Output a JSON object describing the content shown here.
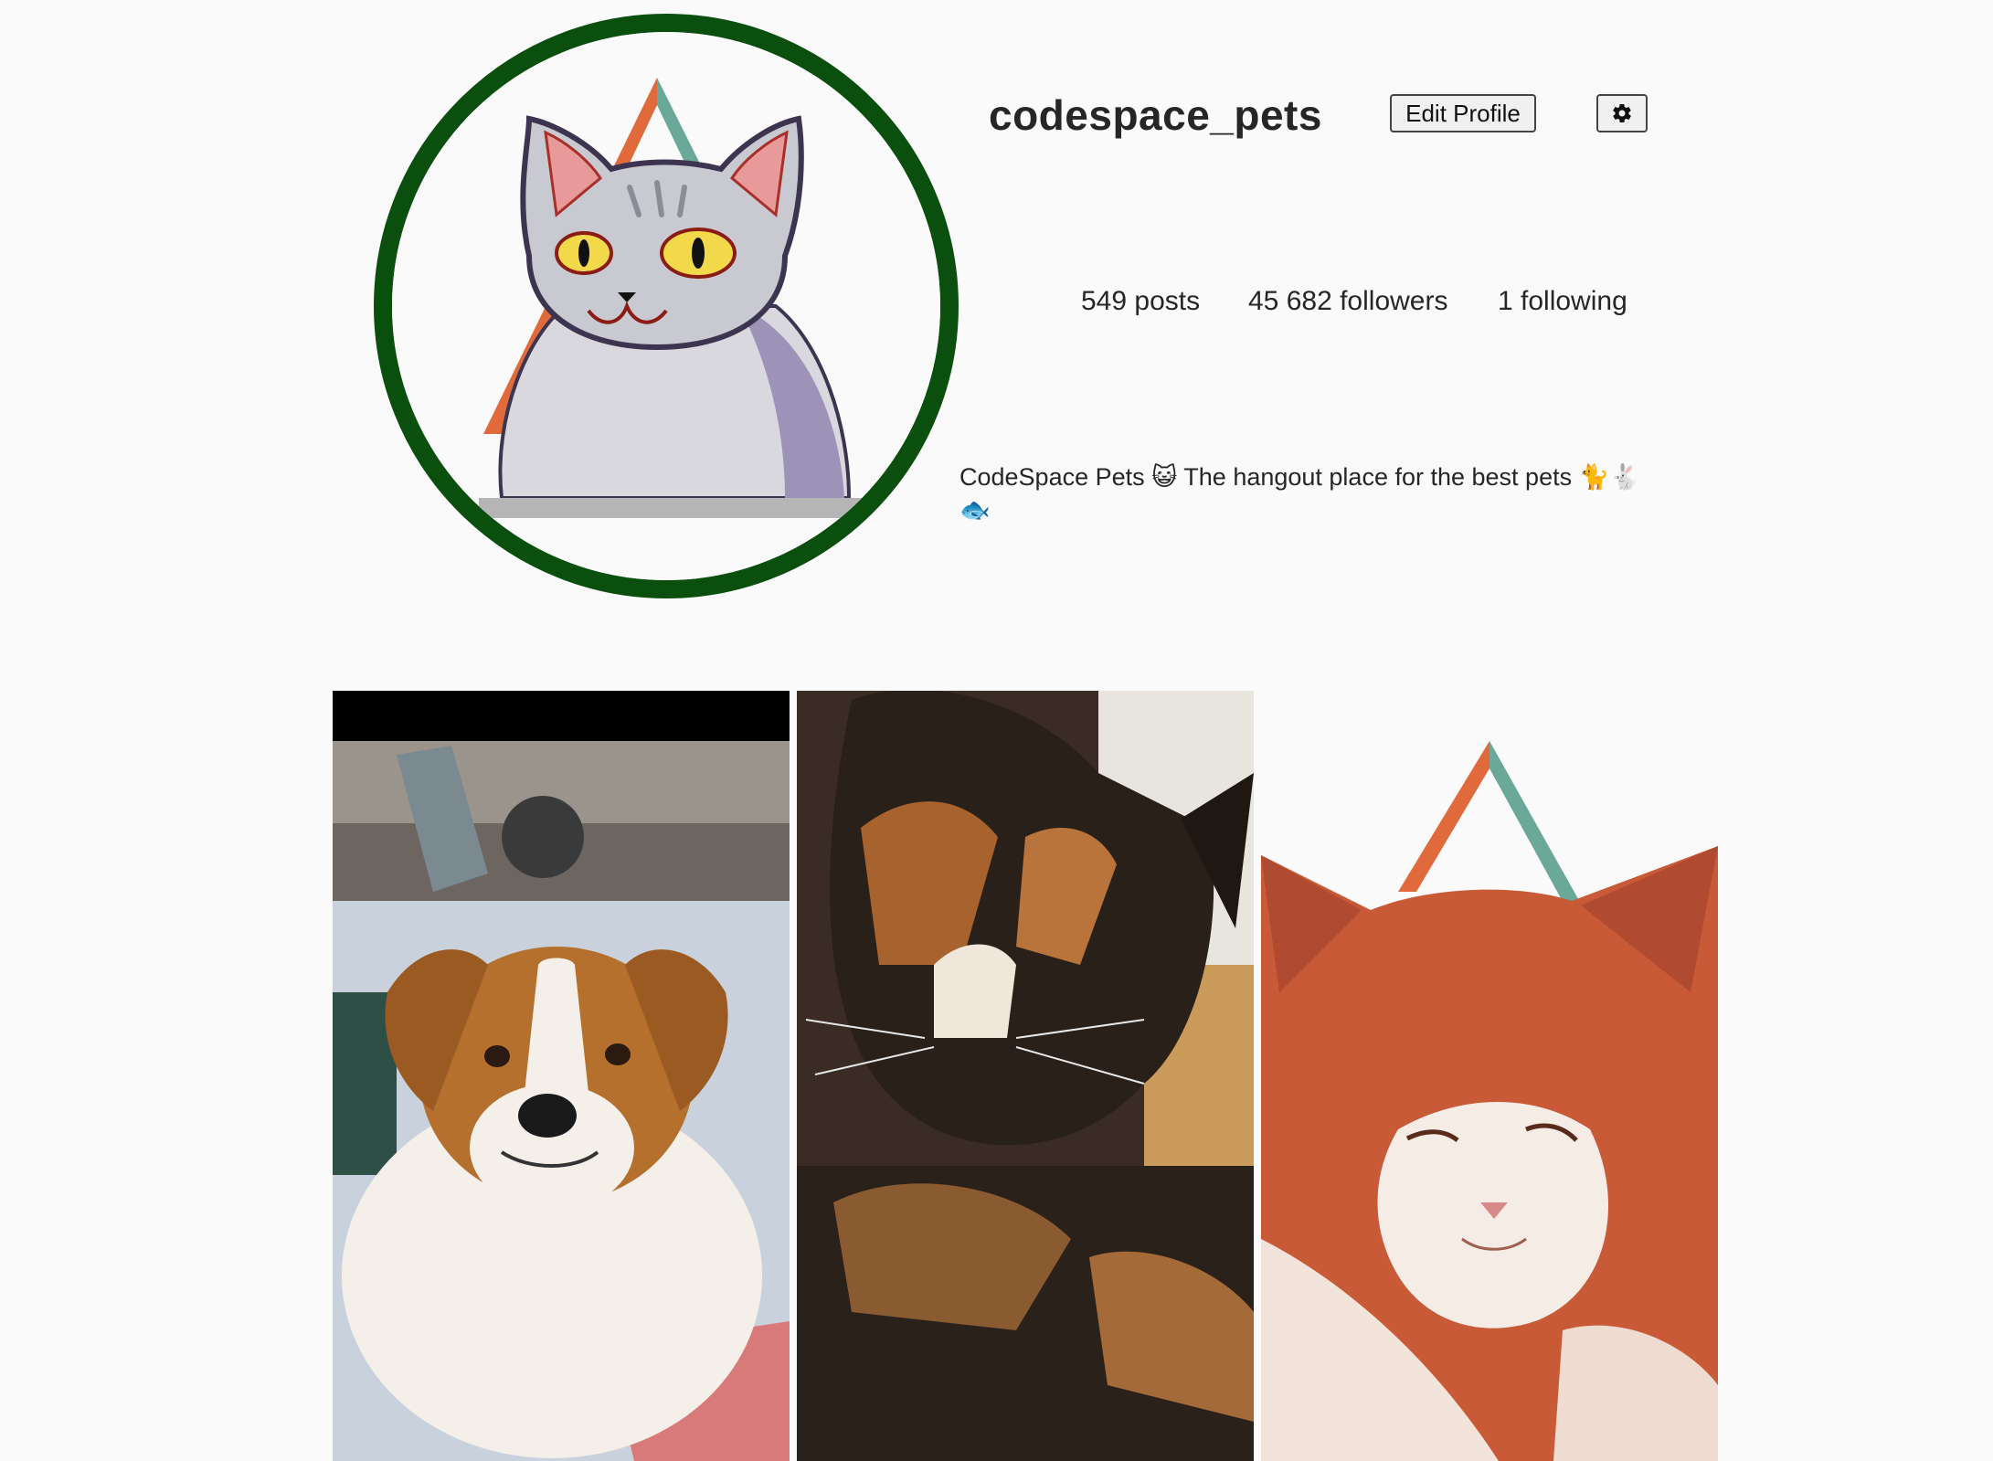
{
  "profile": {
    "username": "codespace_pets",
    "edit_profile_label": "Edit Profile",
    "settings_icon": "gear-icon",
    "avatar_ring_color": "#0a4f0e",
    "stats": {
      "posts": "549 posts",
      "followers": "45 682 followers",
      "following": "1 following"
    },
    "bio": "CodeSpace Pets 😺 The hangout place for the best pets 🐈🐇 🐟"
  },
  "posts": [
    {
      "subject": "dog"
    },
    {
      "subject": "calico-cat"
    },
    {
      "subject": "orange-cat"
    }
  ],
  "brand_colors": {
    "triangle_left": "#e06a3c",
    "triangle_right": "#6aa898"
  }
}
